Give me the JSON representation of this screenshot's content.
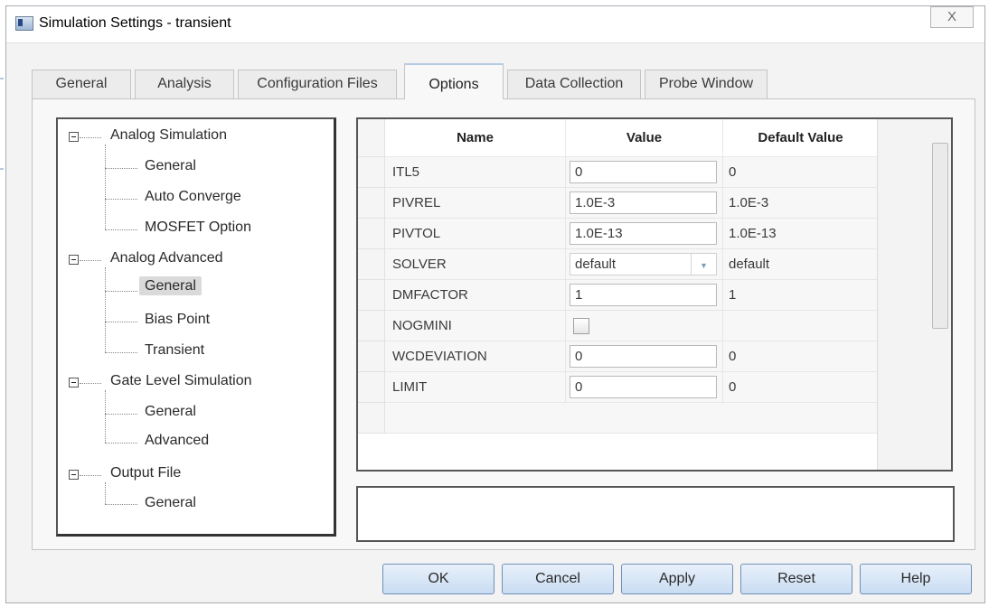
{
  "window": {
    "title": "Simulation Settings - transient",
    "close_glyph": "X"
  },
  "tabs": [
    {
      "label": "General"
    },
    {
      "label": "Analysis"
    },
    {
      "label": "Configuration Files"
    },
    {
      "label": "Options"
    },
    {
      "label": "Data Collection"
    },
    {
      "label": "Probe Window"
    }
  ],
  "active_tab": "Options",
  "tree": {
    "groups": [
      {
        "label": "Analog Simulation",
        "children": [
          "General",
          "Auto Converge",
          "MOSFET Option"
        ]
      },
      {
        "label": "Analog Advanced",
        "children": [
          "General",
          "Bias Point",
          "Transient"
        ],
        "selected_child": "General"
      },
      {
        "label": "Gate Level Simulation",
        "children": [
          "General",
          "Advanced"
        ]
      },
      {
        "label": "Output File",
        "children": [
          "General"
        ]
      }
    ]
  },
  "grid": {
    "headers": {
      "name": "Name",
      "value": "Value",
      "default": "Default Value"
    },
    "rows": [
      {
        "name": "ITL5",
        "value": "0",
        "default": "0",
        "kind": "text"
      },
      {
        "name": "PIVREL",
        "value": "1.0E-3",
        "default": "1.0E-3",
        "kind": "text"
      },
      {
        "name": "PIVTOL",
        "value": "1.0E-13",
        "default": "1.0E-13",
        "kind": "text"
      },
      {
        "name": "SOLVER",
        "value": "default",
        "default": "default",
        "kind": "combo"
      },
      {
        "name": "DMFACTOR",
        "value": "1",
        "default": "1",
        "kind": "text"
      },
      {
        "name": "NOGMINI",
        "value": "",
        "default": "",
        "kind": "checkbox"
      },
      {
        "name": "WCDEVIATION",
        "value": "0",
        "default": "0",
        "kind": "text"
      },
      {
        "name": "LIMIT",
        "value": "0",
        "default": "0",
        "kind": "text"
      }
    ]
  },
  "buttons": {
    "ok": "OK",
    "cancel": "Cancel",
    "apply": "Apply",
    "reset": "Reset",
    "help": "Help"
  },
  "colors": {
    "button_top": "#e9f1fb",
    "button_bottom": "#c9dcf2",
    "button_border": "#6f8fb8",
    "tab_active_accent": "#b6cbe3"
  }
}
